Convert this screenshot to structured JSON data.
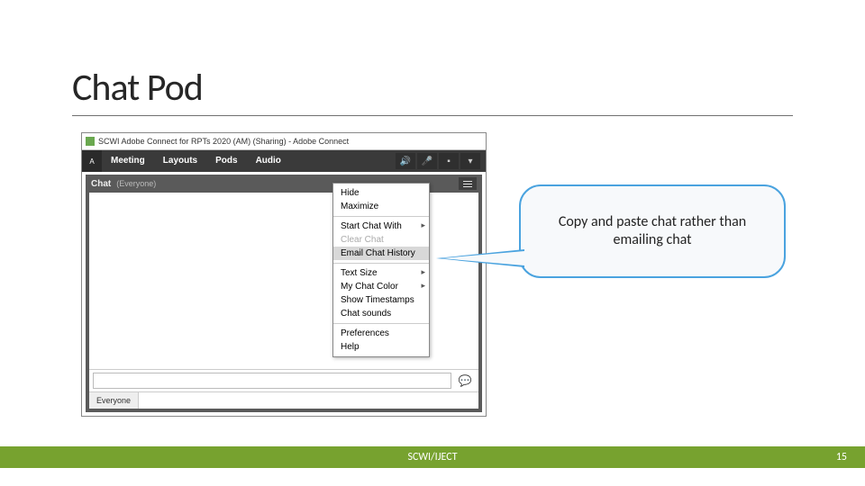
{
  "title": "Chat Pod",
  "window_title": "SCWI Adobe Connect for RPTs 2020 (AM) (Sharing) - Adobe Connect",
  "menubar": [
    "Meeting",
    "Layouts",
    "Pods",
    "Audio"
  ],
  "chat": {
    "title": "Chat",
    "subtitle": "(Everyone)",
    "tab": "Everyone"
  },
  "dropdown": {
    "hide": "Hide",
    "maximize": "Maximize",
    "start_chat_with": "Start Chat With",
    "clear_chat": "Clear Chat",
    "email_chat_history": "Email Chat History",
    "text_size": "Text Size",
    "my_chat_color": "My Chat Color",
    "show_timestamps": "Show Timestamps",
    "chat_sounds": "Chat sounds",
    "preferences": "Preferences",
    "help": "Help"
  },
  "callout_text": "Copy and paste chat rather than emailing chat",
  "footer": {
    "center": "SCWI/IJECT",
    "page": "15"
  },
  "colors": {
    "accent_green": "#77a22f",
    "callout_border": "#4aa3df"
  }
}
